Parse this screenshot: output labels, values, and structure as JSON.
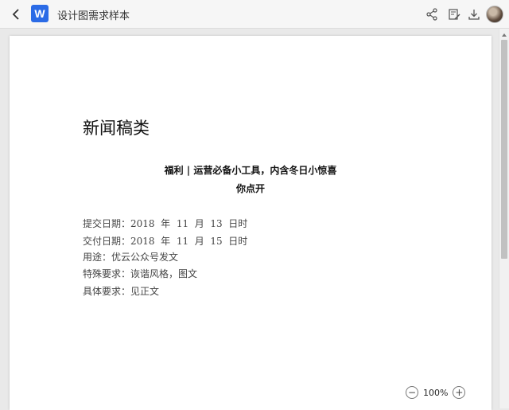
{
  "header": {
    "back_icon": "chevron-left-icon",
    "app_icon_letter": "W",
    "app_icon_color": "#2b6be6",
    "document_title": "设计图需求样本",
    "actions": [
      "share-icon",
      "edit-icon",
      "download-icon"
    ]
  },
  "document": {
    "heading": "新闻稿类",
    "subtitle_line1": "福利 | 运营必备小工具，内含冬日小惊喜",
    "subtitle_line2": "你点开",
    "fields": [
      {
        "label": "提交日期：",
        "value": "2018  年  11  月  13  日时"
      },
      {
        "label": "交付日期：",
        "value": "2018  年  11  月  15  日时"
      },
      {
        "label": "用途：",
        "value": "优云公众号发文"
      },
      {
        "label": "特殊要求：",
        "value": "诙谐风格，图文"
      },
      {
        "label": "具体要求：",
        "value": "见正文"
      }
    ]
  },
  "zoom": {
    "zoom_out_symbol": "−",
    "value": "100%",
    "zoom_in_symbol": "+"
  }
}
